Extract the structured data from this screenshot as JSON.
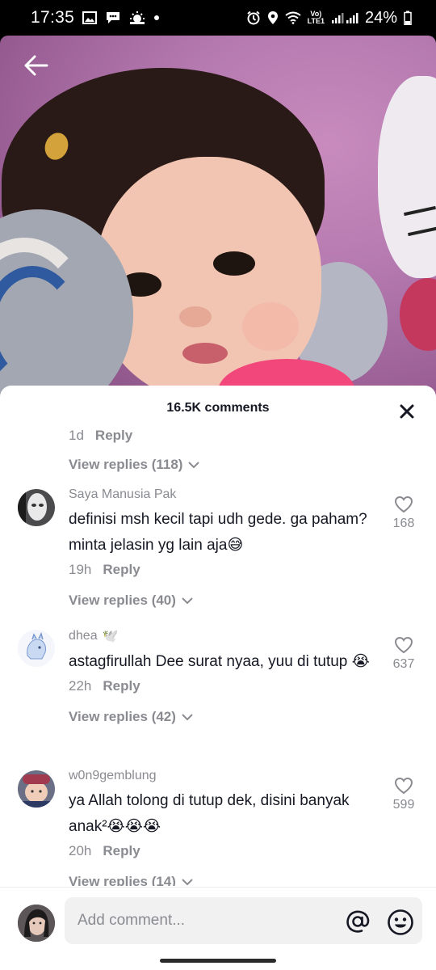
{
  "status_bar": {
    "time": "17:35",
    "battery": "24%",
    "network_label_top": "Vo)",
    "network_label_bottom": "LTE1",
    "left_icons": [
      "gallery-icon",
      "chat-icon",
      "weather-icon",
      "dot-icon"
    ],
    "right_icons": [
      "alarm-icon",
      "location-icon",
      "wifi-icon",
      "signal-icon",
      "battery-icon"
    ]
  },
  "sheet": {
    "title": "16.5K comments"
  },
  "top_partial": {
    "time": "1d",
    "reply_label": "Reply",
    "view_replies": "View replies (118)"
  },
  "comments": [
    {
      "username": "Saya Manusia Pak",
      "text": "definisi msh kecil tapi udh gede. ga paham? minta jelasin yg lain aja😅",
      "time": "19h",
      "reply_label": "Reply",
      "likes": "168",
      "view_replies": "View replies (40)"
    },
    {
      "username": "dhea",
      "username_badge": "🕊️",
      "text": "astagfirullah Dee surat nyaa, yuu di tutup 😭",
      "time": "22h",
      "reply_label": "Reply",
      "likes": "637",
      "view_replies": "View replies (42)"
    },
    {
      "username": "w0n9gemblung",
      "text": "ya Allah tolong di tutup dek, disini banyak anak²😭😭😭",
      "time": "20h",
      "reply_label": "Reply",
      "likes": "599",
      "view_replies": "View replies (14)"
    }
  ],
  "composer": {
    "placeholder": "Add comment..."
  }
}
